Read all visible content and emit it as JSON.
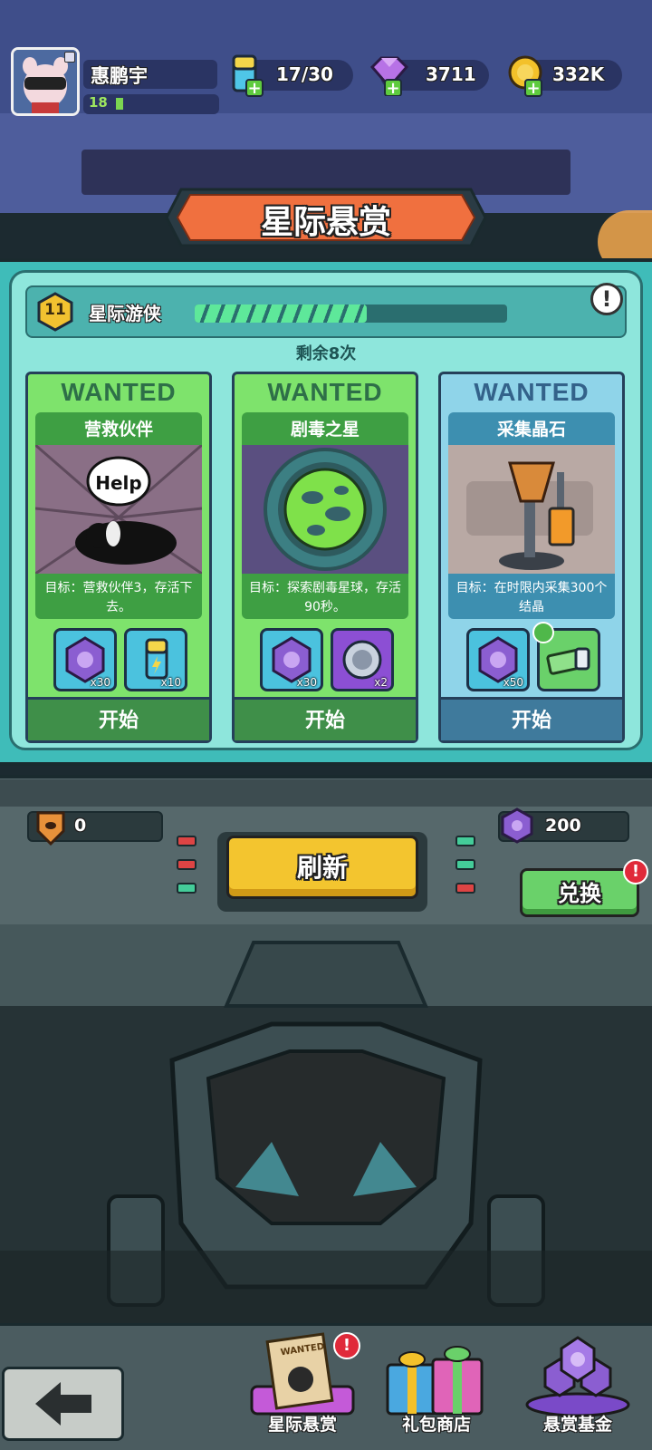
{
  "player": {
    "name": "惠鹏宇",
    "level": "18"
  },
  "resources": {
    "energy": "17/30",
    "gems": "3711",
    "coins": "332K"
  },
  "title": "星际悬赏",
  "rank": {
    "level": "11",
    "name": "星际游侠",
    "progress": 0.55
  },
  "remaining": "剩余8次",
  "cards": [
    {
      "wanted": "WANTED",
      "name": "营救伙伴",
      "badge": "Help",
      "desc": "目标：营救伙伴3，存活下去。",
      "rewards": [
        {
          "icon": "purple-token-icon",
          "count": "x30"
        },
        {
          "icon": "energy-battery-icon",
          "count": "x10"
        }
      ],
      "start": "开始",
      "color": "green"
    },
    {
      "wanted": "WANTED",
      "name": "剧毒之星",
      "desc": "目标：探索剧毒星球，存活90秒。",
      "rewards": [
        {
          "icon": "purple-token-icon",
          "count": "x30"
        },
        {
          "icon": "silver-coin-icon",
          "count": "x2"
        }
      ],
      "start": "开始",
      "color": "green"
    },
    {
      "wanted": "WANTED",
      "name": "采集晶石",
      "desc": "目标：在时限内采集300个结晶",
      "rewards": [
        {
          "icon": "purple-token-icon",
          "count": "x50"
        },
        {
          "icon": "cash-icon",
          "count": ""
        }
      ],
      "start": "开始",
      "color": "blue"
    }
  ],
  "console": {
    "badge_count": "0",
    "token_count": "200",
    "refresh": "刷新",
    "exchange": "兑换"
  },
  "bottom_tabs": [
    {
      "label": "星际悬赏",
      "badge": "WANTED"
    },
    {
      "label": "礼包商店"
    },
    {
      "label": "悬赏基金"
    }
  ]
}
